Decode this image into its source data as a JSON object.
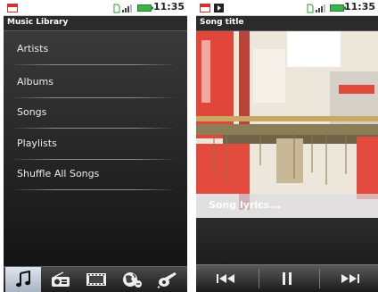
{
  "library": {
    "status_time": "11:35",
    "title": "Music Library",
    "items": [
      "Artists",
      "Albums",
      "Songs",
      "Playlists",
      "Shuffle All Songs"
    ],
    "tabs": [
      {
        "icon": "music-note-icon",
        "active": true
      },
      {
        "icon": "radio-icon",
        "active": false
      },
      {
        "icon": "film-icon",
        "active": false
      },
      {
        "icon": "globe-icon",
        "active": false
      },
      {
        "icon": "guitar-icon",
        "active": false
      }
    ]
  },
  "player": {
    "status_time": "11:35",
    "title": "Song title",
    "lyrics": "Song lyrics...",
    "controls": [
      "previous-icon",
      "pause-icon",
      "next-icon"
    ]
  },
  "colors": {
    "accent_red": "#e0483a",
    "battery_green": "#3cb34a",
    "background_dark": "#1b1b1b"
  }
}
